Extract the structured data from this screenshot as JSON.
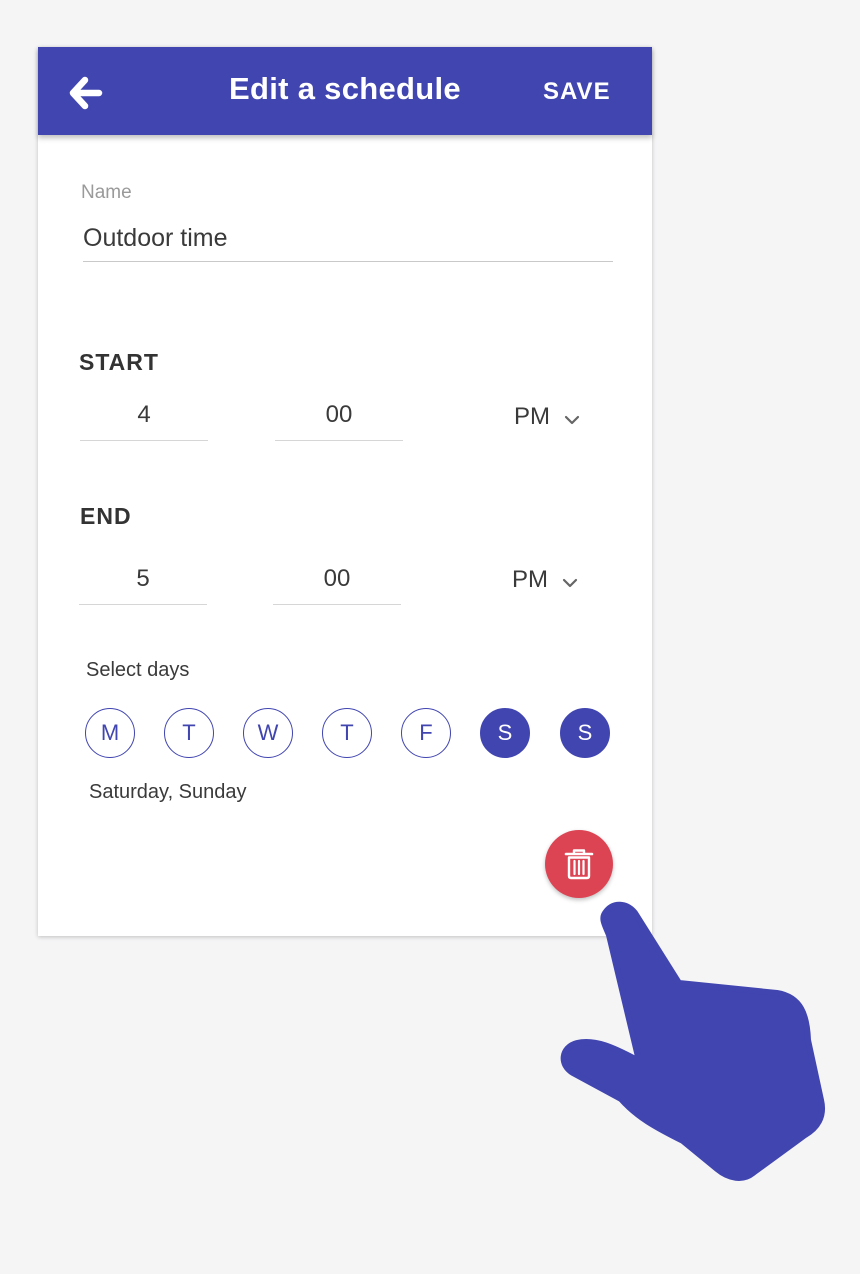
{
  "header": {
    "title": "Edit a schedule",
    "save_label": "SAVE",
    "back_icon": "arrow-left-icon"
  },
  "name": {
    "label": "Name",
    "value": "Outdoor time"
  },
  "start": {
    "heading": "START",
    "hour": "4",
    "minute": "00",
    "period": "PM"
  },
  "end": {
    "heading": "END",
    "hour": "5",
    "minute": "00",
    "period": "PM"
  },
  "days": {
    "label": "Select days",
    "items": [
      {
        "letter": "M",
        "selected": false
      },
      {
        "letter": "T",
        "selected": false
      },
      {
        "letter": "W",
        "selected": false
      },
      {
        "letter": "T",
        "selected": false
      },
      {
        "letter": "F",
        "selected": false
      },
      {
        "letter": "S",
        "selected": true
      },
      {
        "letter": "S",
        "selected": true
      }
    ],
    "summary": "Saturday, Sunday"
  },
  "delete_icon": "trash-icon",
  "hand_icon": "pointing-hand-icon",
  "colors": {
    "primary": "#4145b0",
    "danger": "#dc4453",
    "background": "#f5f5f6"
  }
}
